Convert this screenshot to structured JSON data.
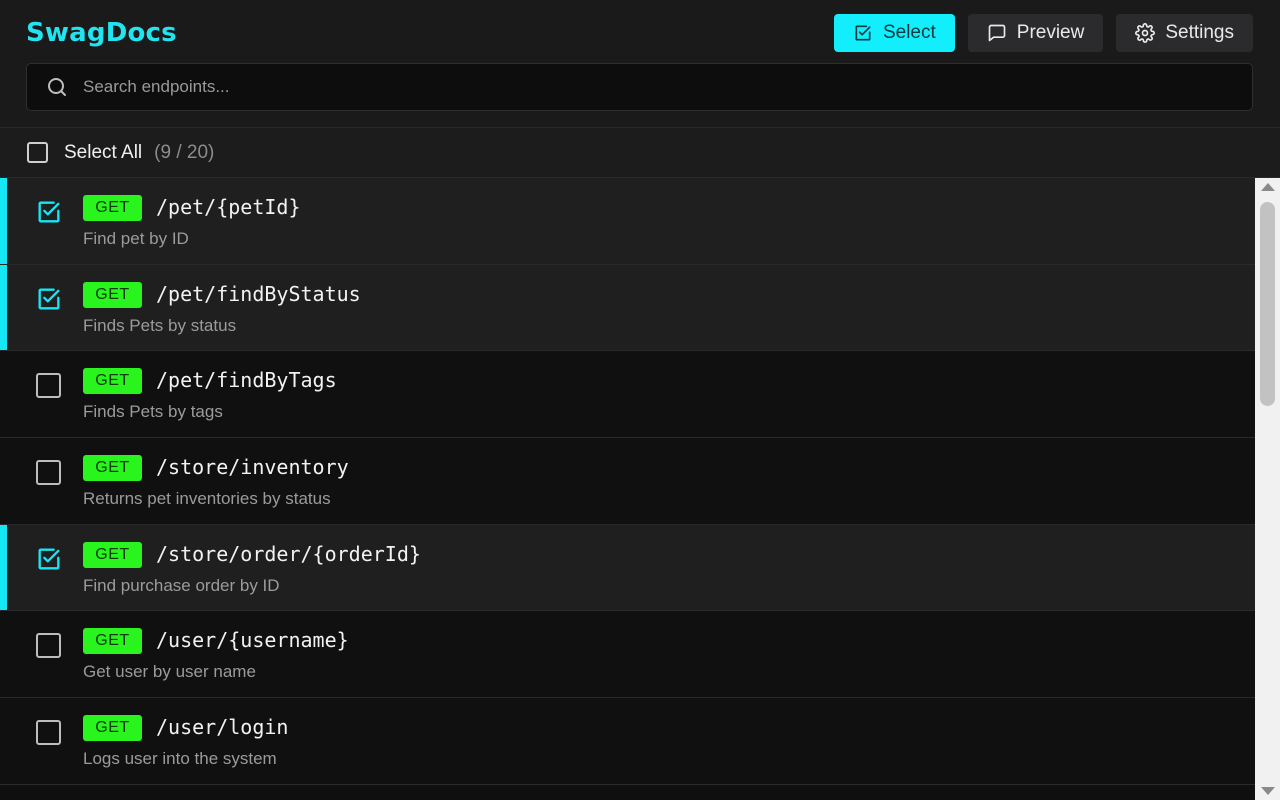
{
  "app": {
    "brand": "SwagDocs"
  },
  "toolbar": {
    "select_label": "Select",
    "preview_label": "Preview",
    "settings_label": "Settings"
  },
  "search": {
    "placeholder": "Search endpoints..."
  },
  "selection": {
    "label": "Select All",
    "count": "(9 / 20)"
  },
  "endpoints": [
    {
      "method": "GET",
      "path": "/pet/{petId}",
      "description": "Find pet by ID",
      "selected": true
    },
    {
      "method": "GET",
      "path": "/pet/findByStatus",
      "description": "Finds Pets by status",
      "selected": true
    },
    {
      "method": "GET",
      "path": "/pet/findByTags",
      "description": "Finds Pets by tags",
      "selected": false
    },
    {
      "method": "GET",
      "path": "/store/inventory",
      "description": "Returns pet inventories by status",
      "selected": false
    },
    {
      "method": "GET",
      "path": "/store/order/{orderId}",
      "description": "Find purchase order by ID",
      "selected": true
    },
    {
      "method": "GET",
      "path": "/user/{username}",
      "description": "Get user by user name",
      "selected": false
    },
    {
      "method": "GET",
      "path": "/user/login",
      "description": "Logs user into the system",
      "selected": false
    }
  ],
  "colors": {
    "accent": "#16e7f5",
    "get_badge": "#29f41e",
    "background": "#0f0f10"
  }
}
